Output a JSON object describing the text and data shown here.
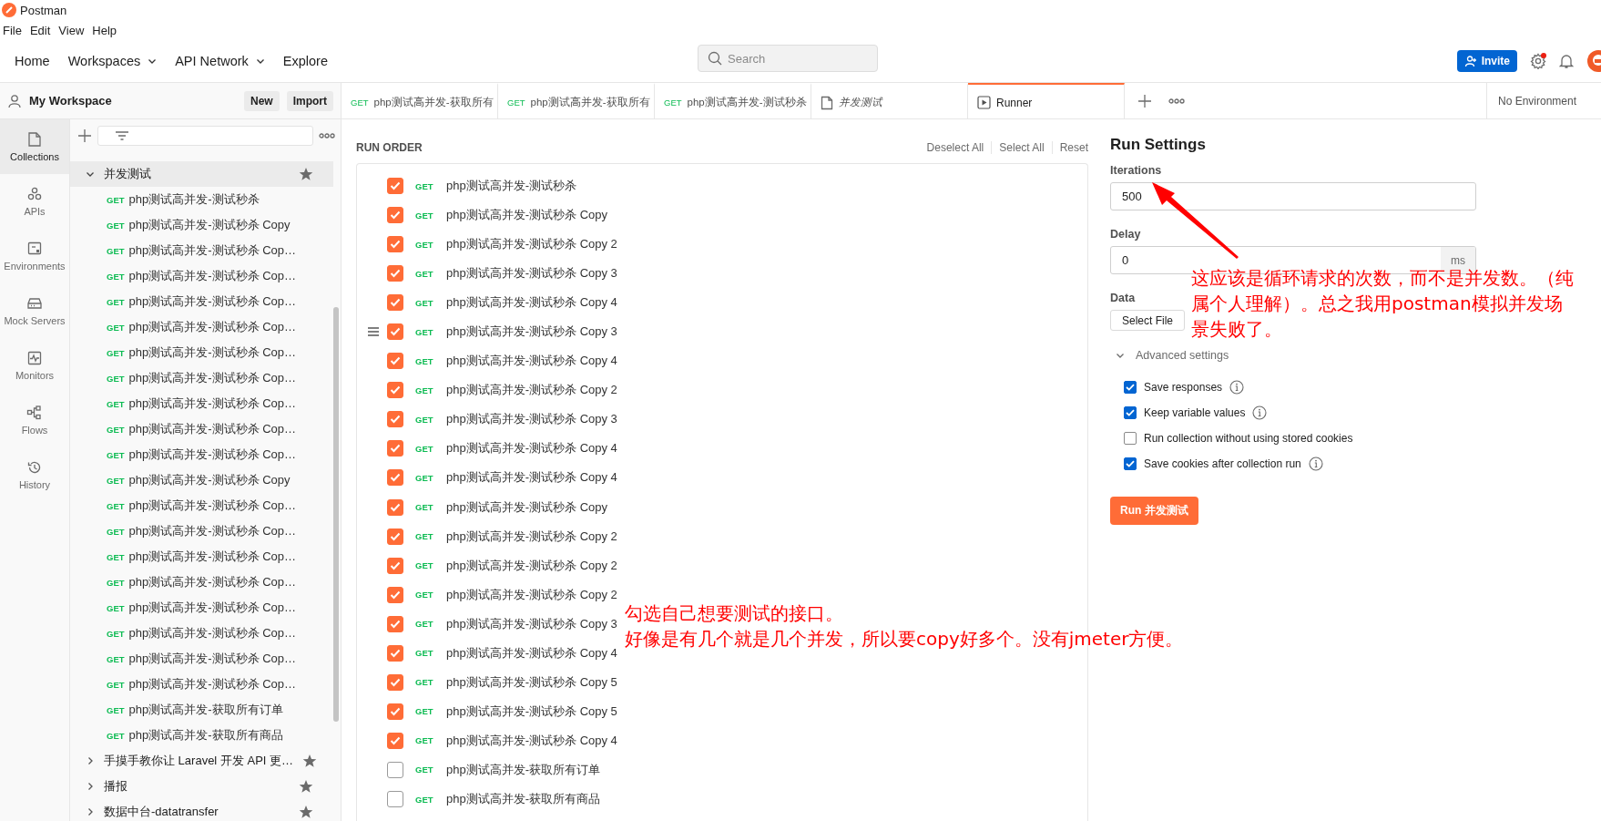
{
  "app": {
    "title": "Postman"
  },
  "menu": [
    "File",
    "Edit",
    "View",
    "Help"
  ],
  "nav": {
    "items": [
      {
        "label": "Home",
        "dropdown": false
      },
      {
        "label": "Workspaces",
        "dropdown": true
      },
      {
        "label": "API Network",
        "dropdown": true
      },
      {
        "label": "Explore",
        "dropdown": false
      }
    ],
    "search": {
      "placeholder": "Search"
    },
    "invite": "Invite",
    "settings_badge": true
  },
  "workspace": {
    "name": "My Workspace",
    "buttons": [
      "New",
      "Import"
    ]
  },
  "left_nav": [
    {
      "kind": "collections",
      "label": "Collections",
      "selected": true
    },
    {
      "kind": "apis",
      "label": "APIs",
      "selected": false
    },
    {
      "kind": "environments",
      "label": "Environments",
      "selected": false
    },
    {
      "kind": "mock",
      "label": "Mock Servers",
      "selected": false
    },
    {
      "kind": "monitors",
      "label": "Monitors",
      "selected": false
    },
    {
      "kind": "flows",
      "label": "Flows",
      "selected": false
    },
    {
      "kind": "history",
      "label": "History",
      "selected": false
    }
  ],
  "collections": [
    {
      "name": "并发测试",
      "expanded": true,
      "children": [
        {
          "method": "GET",
          "name": "php测试高并发-测试秒杀"
        },
        {
          "method": "GET",
          "name": "php测试高并发-测试秒杀 Copy"
        },
        {
          "method": "GET",
          "name": "php测试高并发-测试秒杀 Cop…"
        },
        {
          "method": "GET",
          "name": "php测试高并发-测试秒杀 Cop…"
        },
        {
          "method": "GET",
          "name": "php测试高并发-测试秒杀 Cop…"
        },
        {
          "method": "GET",
          "name": "php测试高并发-测试秒杀 Cop…"
        },
        {
          "method": "GET",
          "name": "php测试高并发-测试秒杀 Cop…"
        },
        {
          "method": "GET",
          "name": "php测试高并发-测试秒杀 Cop…"
        },
        {
          "method": "GET",
          "name": "php测试高并发-测试秒杀 Cop…"
        },
        {
          "method": "GET",
          "name": "php测试高并发-测试秒杀 Cop…"
        },
        {
          "method": "GET",
          "name": "php测试高并发-测试秒杀 Cop…"
        },
        {
          "method": "GET",
          "name": "php测试高并发-测试秒杀 Copy"
        },
        {
          "method": "GET",
          "name": "php测试高并发-测试秒杀 Cop…"
        },
        {
          "method": "GET",
          "name": "php测试高并发-测试秒杀 Cop…"
        },
        {
          "method": "GET",
          "name": "php测试高并发-测试秒杀 Cop…"
        },
        {
          "method": "GET",
          "name": "php测试高并发-测试秒杀 Cop…"
        },
        {
          "method": "GET",
          "name": "php测试高并发-测试秒杀 Cop…"
        },
        {
          "method": "GET",
          "name": "php测试高并发-测试秒杀 Cop…"
        },
        {
          "method": "GET",
          "name": "php测试高并发-测试秒杀 Cop…"
        },
        {
          "method": "GET",
          "name": "php测试高并发-测试秒杀 Cop…"
        },
        {
          "method": "GET",
          "name": "php测试高并发-获取所有订单"
        },
        {
          "method": "GET",
          "name": "php测试高并发-获取所有商品"
        }
      ]
    },
    {
      "name": "手摸手教你让 Laravel 开发 API 更…",
      "expanded": false
    },
    {
      "name": "播报",
      "expanded": false
    },
    {
      "name": "数据中台-datatransfer",
      "expanded": false
    }
  ],
  "tabs": [
    {
      "kind": "request",
      "method": "GET",
      "label": "php测试高并发-获取所有",
      "selected": false
    },
    {
      "kind": "request",
      "method": "GET",
      "label": "php测试高并发-获取所有",
      "selected": false
    },
    {
      "kind": "request",
      "method": "GET",
      "label": "php测试高并发-测试秒杀",
      "selected": false
    },
    {
      "kind": "folder",
      "label": "并发测试",
      "selected": false
    },
    {
      "kind": "runner",
      "label": "Runner",
      "selected": true
    }
  ],
  "environment": "No Environment",
  "run_order": {
    "title": "RUN ORDER",
    "actions": [
      "Deselect All",
      "Select All",
      "Reset"
    ],
    "requests": [
      {
        "method": "GET",
        "name": "php测试高并发-测试秒杀",
        "checked": true,
        "hovered": false
      },
      {
        "method": "GET",
        "name": "php测试高并发-测试秒杀 Copy",
        "checked": true,
        "hovered": false
      },
      {
        "method": "GET",
        "name": "php测试高并发-测试秒杀 Copy 2",
        "checked": true,
        "hovered": false
      },
      {
        "method": "GET",
        "name": "php测试高并发-测试秒杀 Copy 3",
        "checked": true,
        "hovered": false
      },
      {
        "method": "GET",
        "name": "php测试高并发-测试秒杀 Copy 4",
        "checked": true,
        "hovered": false
      },
      {
        "method": "GET",
        "name": "php测试高并发-测试秒杀 Copy 3",
        "checked": true,
        "hovered": true
      },
      {
        "method": "GET",
        "name": "php测试高并发-测试秒杀 Copy 4",
        "checked": true,
        "hovered": false
      },
      {
        "method": "GET",
        "name": "php测试高并发-测试秒杀 Copy 2",
        "checked": true,
        "hovered": false
      },
      {
        "method": "GET",
        "name": "php测试高并发-测试秒杀 Copy 3",
        "checked": true,
        "hovered": false
      },
      {
        "method": "GET",
        "name": "php测试高并发-测试秒杀 Copy 4",
        "checked": true,
        "hovered": false
      },
      {
        "method": "GET",
        "name": "php测试高并发-测试秒杀 Copy 4",
        "checked": true,
        "hovered": false
      },
      {
        "method": "GET",
        "name": "php测试高并发-测试秒杀 Copy",
        "checked": true,
        "hovered": false
      },
      {
        "method": "GET",
        "name": "php测试高并发-测试秒杀 Copy 2",
        "checked": true,
        "hovered": false
      },
      {
        "method": "GET",
        "name": "php测试高并发-测试秒杀 Copy 2",
        "checked": true,
        "hovered": false
      },
      {
        "method": "GET",
        "name": "php测试高并发-测试秒杀 Copy 2",
        "checked": true,
        "hovered": false
      },
      {
        "method": "GET",
        "name": "php测试高并发-测试秒杀 Copy 3",
        "checked": true,
        "hovered": false
      },
      {
        "method": "GET",
        "name": "php测试高并发-测试秒杀 Copy 4",
        "checked": true,
        "hovered": false
      },
      {
        "method": "GET",
        "name": "php测试高并发-测试秒杀 Copy 5",
        "checked": true,
        "hovered": false
      },
      {
        "method": "GET",
        "name": "php测试高并发-测试秒杀 Copy 5",
        "checked": true,
        "hovered": false
      },
      {
        "method": "GET",
        "name": "php测试高并发-测试秒杀 Copy 4",
        "checked": true,
        "hovered": false
      },
      {
        "method": "GET",
        "name": "php测试高并发-获取所有订单",
        "checked": false,
        "hovered": false
      },
      {
        "method": "GET",
        "name": "php测试高并发-获取所有商品",
        "checked": false,
        "hovered": false
      }
    ]
  },
  "run_settings": {
    "title": "Run Settings",
    "iterations": {
      "label": "Iterations",
      "value": "500"
    },
    "delay": {
      "label": "Delay",
      "value": "0",
      "unit": "ms"
    },
    "data": {
      "label": "Data",
      "button": "Select File"
    },
    "advanced": {
      "label": "Advanced settings",
      "expanded": true,
      "options": [
        {
          "label": "Save responses",
          "checked": true,
          "info": true
        },
        {
          "label": "Keep variable values",
          "checked": true,
          "info": true
        },
        {
          "label": "Run collection without using stored cookies",
          "checked": false,
          "info": false
        },
        {
          "label": "Save cookies after collection run",
          "checked": true,
          "info": true
        }
      ]
    },
    "run_button": "Run 并发测试"
  },
  "annotations": [
    {
      "text": "这应该是循环请求的次数，而不是并发数。（纯属个人理解）。总之我用postman模拟并发场景失败了。"
    },
    {
      "text": "勾选自己想要测试的接口。"
    },
    {
      "text": "好像是有几个就是几个并发，所以要copy好多个。没有jmeter方便。"
    }
  ]
}
